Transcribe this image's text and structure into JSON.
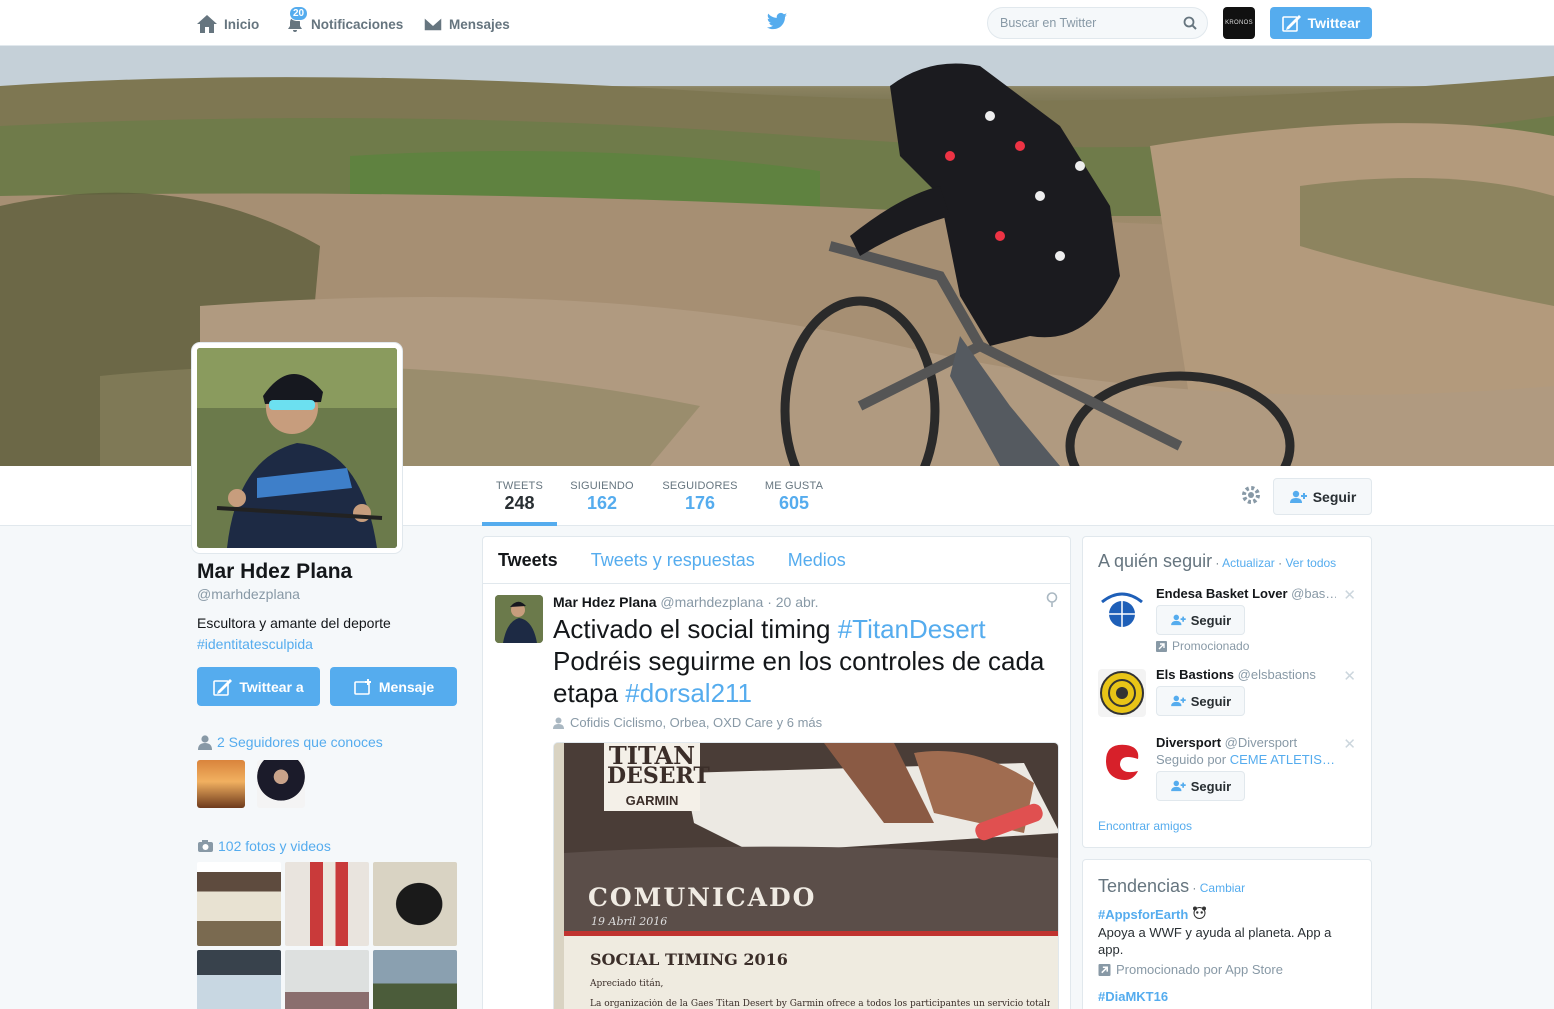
{
  "nav": {
    "home_label": "Inicio",
    "notifications_label": "Notificaciones",
    "notifications_count": "20",
    "messages_label": "Mensajes",
    "search_placeholder": "Buscar en Twitter",
    "own_avatar_text": "KRONOS",
    "tweet_button": "Twittear"
  },
  "stats": [
    {
      "label": "TWEETS",
      "value": "248"
    },
    {
      "label": "SIGUIENDO",
      "value": "162"
    },
    {
      "label": "SEGUIDORES",
      "value": "176"
    },
    {
      "label": "ME GUSTA",
      "value": "605"
    }
  ],
  "follow_button": "Seguir",
  "profile": {
    "name": "Mar Hdez Plana",
    "handle": "@marhdezplana",
    "bio": "Escultora y amante del deporte",
    "hashtag": "#identitatesculpida",
    "tweet_to_button": "Twittear a",
    "message_button": "Mensaje",
    "followers_you_know": "2 Seguidores que conoces",
    "photos_videos": "102 fotos y videos"
  },
  "timeline": {
    "tabs": [
      "Tweets",
      "Tweets y respuestas",
      "Medios"
    ],
    "tweet": {
      "author": "Mar Hdez Plana",
      "handle": "@marhdezplana",
      "date": "· 20 abr.",
      "text_1": "Activado el social timing ",
      "hashtag_1": "#TitanDesert",
      "text_2": "Podréis seguirme en los controles de cada etapa ",
      "hashtag_2": "#dorsal211",
      "tagged": "Cofidis Ciclismo, Orbea, OXD Care y 6 más",
      "media": {
        "logo_line1": "TITAN",
        "logo_line2": "DESERT",
        "logo_line3": "GARMIN",
        "heading": "COMUNICADO",
        "date": "19 Abril 2016",
        "subheading": "SOCIAL TIMING 2016",
        "greeting": "Apreciado titán,",
        "body": "La organización  de la Gaes Titan Desert by Garmin ofrece a todos los participantes un servicio totalmente"
      }
    }
  },
  "who_to_follow": {
    "title": "A quién seguir",
    "refresh": "Actualizar",
    "view_all": "Ver todos",
    "suggestions": [
      {
        "name": "Endesa Basket Lover",
        "handle": "@bas…",
        "button": "Seguir",
        "note": "Promocionado"
      },
      {
        "name": "Els Bastions",
        "handle": "@elsbastions",
        "button": "Seguir"
      },
      {
        "name": "Diversport",
        "handle": "@Diversport",
        "followed_by_prefix": "Seguido por ",
        "followed_by": "CEME ATLETIS…",
        "button": "Seguir"
      }
    ],
    "find_friends": "Encontrar amigos"
  },
  "trends": {
    "title": "Tendencias",
    "change": "Cambiar",
    "items": [
      {
        "tag": "#AppsforEarth",
        "desc": "Apoya a WWF y ayuda al planeta. App a app.",
        "promoted": "Promocionado por App Store"
      },
      {
        "tag": "#DiaMKT16"
      }
    ]
  }
}
